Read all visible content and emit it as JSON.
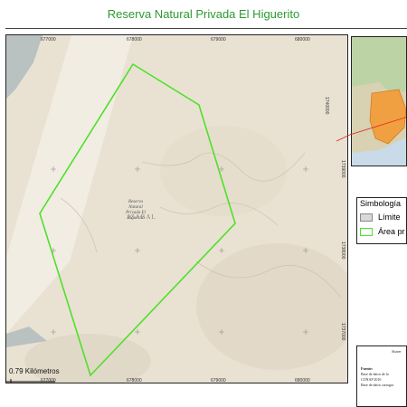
{
  "title": "Reserva Natural Privada El Higuerito",
  "map": {
    "x_ticks": [
      "677000",
      "678000",
      "679000",
      "680000"
    ],
    "y_ticks": [
      "1740000",
      "1739000",
      "1738000",
      "1737000"
    ],
    "reserve_label": [
      "Reserva",
      "Natural",
      "Privada El",
      "Higuerito"
    ],
    "place_label": "IZABAL",
    "boundary_color": "#4fe02a",
    "scale_label": "0.79 Kilómetros"
  },
  "legend": {
    "title": "Simbología",
    "items": [
      {
        "label": "Límite",
        "swatch_fill": "#d9d9d9",
        "swatch_stroke": "#888888"
      },
      {
        "label": "Área pr",
        "swatch_fill": "#ffffff",
        "swatch_stroke": "#4fe02a"
      }
    ]
  },
  "source": {
    "heading": "Sistem",
    "lines": [
      "Fuente:",
      "Base de datos de la",
      "CONAP 2016",
      "Base de datos cartogra"
    ]
  },
  "colors": {
    "title": "#2c9a32",
    "locator_region": "#f0a040",
    "pointer": "#e02020"
  }
}
